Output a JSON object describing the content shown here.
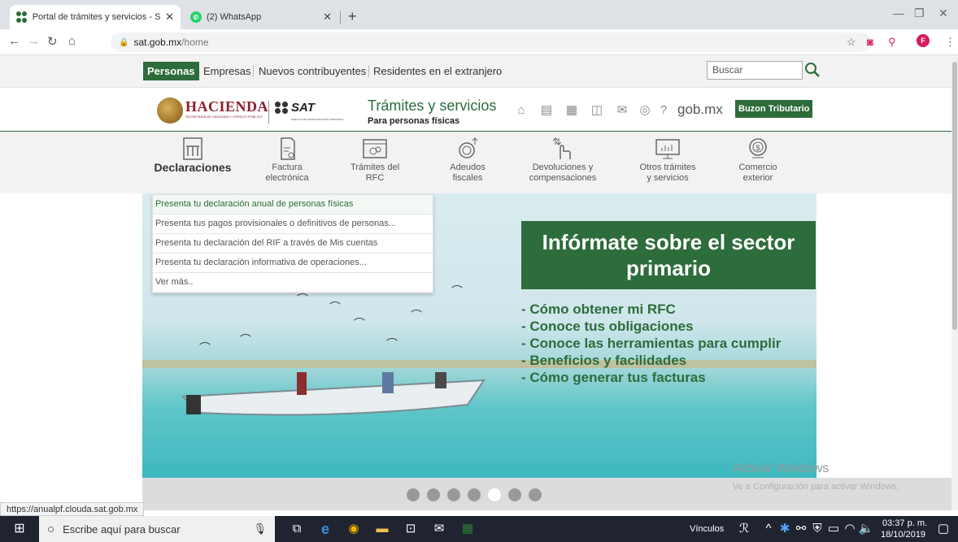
{
  "browser": {
    "tabs": [
      {
        "title": "Portal de trámites y servicios - S/",
        "close": "✕"
      },
      {
        "title": "(2) WhatsApp",
        "close": "✕"
      }
    ],
    "new_tab": "+",
    "url_domain": "sat.gob.mx",
    "url_path": "/home",
    "profile_initial": "F",
    "status_url": "https://anualpf.clouda.sat.gob.mx"
  },
  "top_nav": {
    "items": [
      "Personas",
      "Empresas",
      "Nuevos contribuyentes",
      "Residentes en el extranjero"
    ],
    "search_placeholder": "Buscar"
  },
  "header": {
    "hacienda": "HACIENDA",
    "hacienda_sub": "SECRETARÍA DE HACIENDA Y CRÉDITO PÚBLICO",
    "sat": "SAT",
    "sat_sub": "SERVICIO DE ADMINISTRACIÓN TRIBUTARIA",
    "title": "Trámites y servicios",
    "subtitle": "Para personas físicas",
    "gobmx": "gob.mx",
    "buzon": "Buzon Tributario"
  },
  "categories": [
    {
      "label": "Declaraciones",
      "icon": "declaraciones-icon"
    },
    {
      "label": "Factura\nelectrónica",
      "icon": "factura-icon"
    },
    {
      "label": "Trámites del\nRFC",
      "icon": "rfc-icon"
    },
    {
      "label": "Adeudos\nfiscales",
      "icon": "adeudos-icon"
    },
    {
      "label": "Devoluciones y\ncompensaciones",
      "icon": "devoluciones-icon"
    },
    {
      "label": "Otros trámites\ny servicios",
      "icon": "otros-icon"
    },
    {
      "label": "Comercio\nexterior",
      "icon": "comercio-icon"
    }
  ],
  "dropdown": [
    "Presenta tu declaración anual de personas físicas",
    "Presenta tus pagos provisionales o definitivos de personas...",
    "Presenta tu declaración del RIF a través de Mis cuentas",
    "Presenta tu declaración informativa de operaciones...",
    "Ver más.."
  ],
  "promo": {
    "title": "Infórmate sobre el sector primario",
    "items": [
      "- Cómo obtener mi RFC",
      "- Conoce tus obligaciones",
      "- Conoce las herramientas para cumplir",
      "- Beneficios y facilidades",
      "- Cómo generar tus facturas"
    ]
  },
  "carousel": {
    "count": 7,
    "active": 5
  },
  "watermark": {
    "title": "Activar Windows",
    "sub": "Ve a Configuración para activar Windows."
  },
  "taskbar": {
    "search": "Escribe aquí para buscar",
    "links": "Vínculos",
    "time": "03:37 p. m.",
    "date": "18/10/2019"
  },
  "colors": {
    "brand_green": "#2d6c3b",
    "hacienda_red": "#8a1f2b"
  }
}
